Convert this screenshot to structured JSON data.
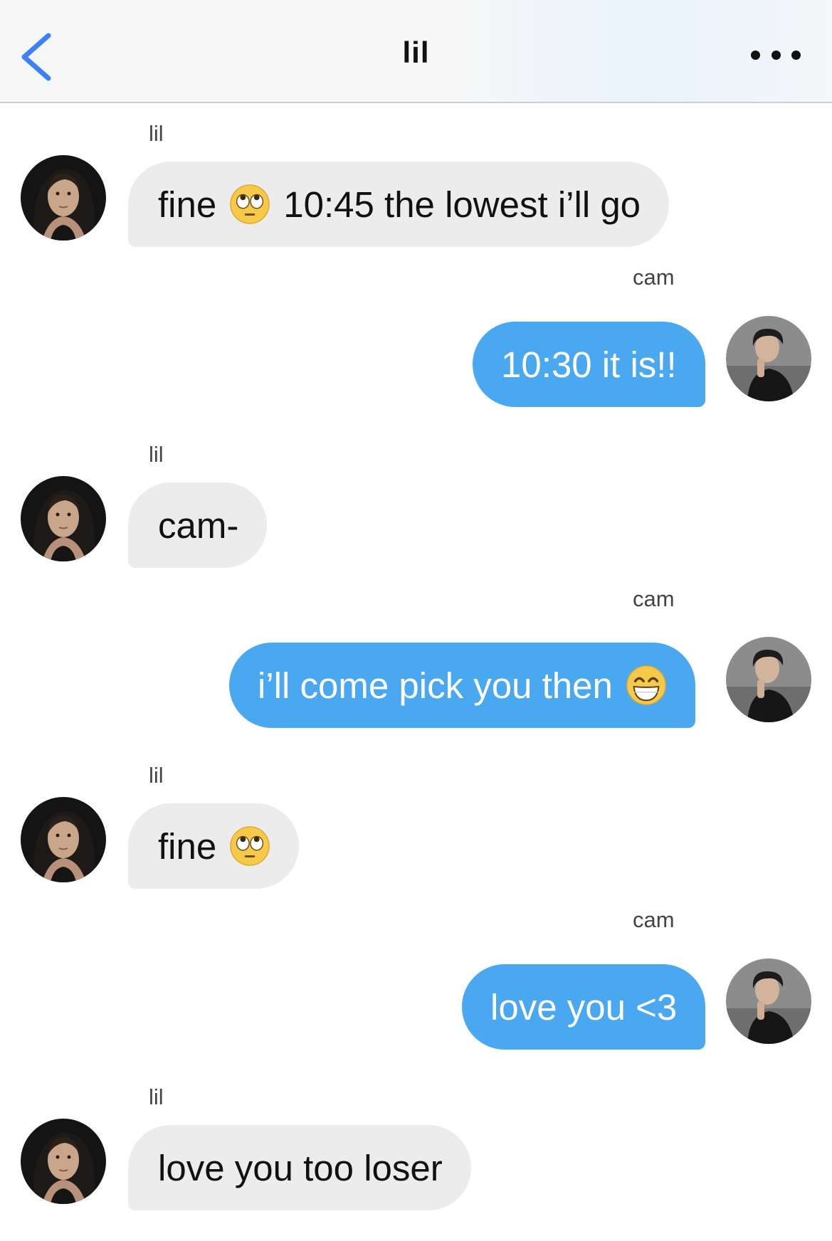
{
  "header": {
    "title": "lil"
  },
  "messages": [
    {
      "sender": "lil",
      "side": "in",
      "before": "fine",
      "emoji": "eye-roll-emoji",
      "after": "10:45 the lowest i’ll go"
    },
    {
      "sender": "cam",
      "side": "out",
      "text": "10:30 it is!!"
    },
    {
      "sender": "lil",
      "side": "in",
      "text": "cam-"
    },
    {
      "sender": "cam",
      "side": "out",
      "before": "i’ll come pick you then",
      "emoji": "grinning-emoji"
    },
    {
      "sender": "lil",
      "side": "in",
      "before": "fine",
      "emoji": "eye-roll-emoji"
    },
    {
      "sender": "cam",
      "side": "out",
      "text": "love you <3"
    },
    {
      "sender": "lil",
      "side": "in",
      "text": "love you too loser"
    }
  ],
  "colors": {
    "incoming_bubble": "#ececec",
    "outgoing_bubble": "#4aa8f1",
    "accent": "#3b82f6"
  }
}
